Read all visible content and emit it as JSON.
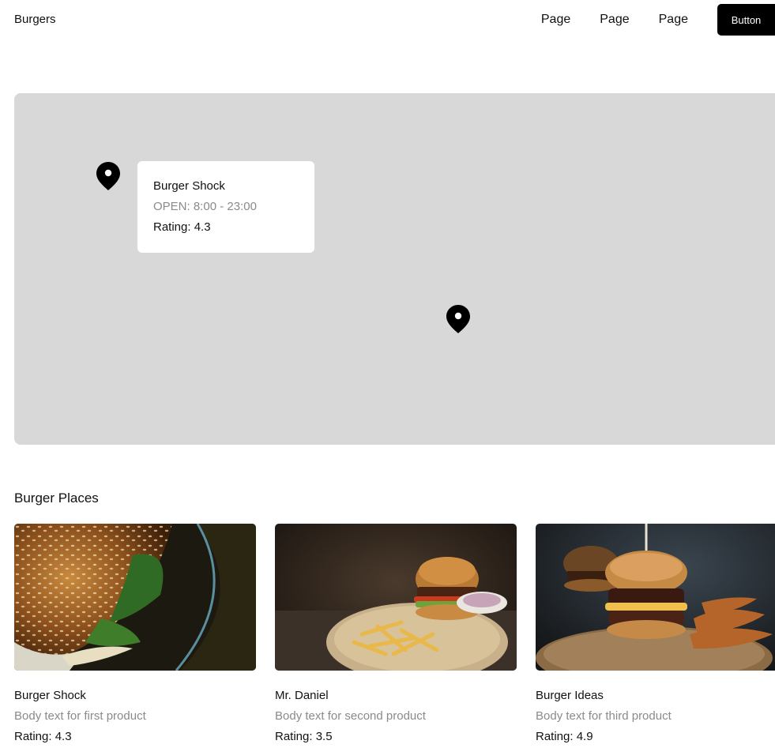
{
  "header": {
    "brand": "Burgers",
    "nav": [
      "Page",
      "Page",
      "Page"
    ],
    "button_label": "Button"
  },
  "map": {
    "popup": {
      "name": "Burger Shock",
      "hours": "OPEN: 8:00 - 23:00",
      "rating": "Rating: 4.3"
    }
  },
  "section": {
    "title": "Burger Places"
  },
  "cards": [
    {
      "name": "Burger Shock",
      "body": "Body text for first product",
      "rating": "Rating: 4.3"
    },
    {
      "name": "Mr. Daniel",
      "body": "Body text for second product",
      "rating": "Rating: 3.5"
    },
    {
      "name": "Burger Ideas",
      "body": "Body text for third product",
      "rating": "Rating: 4.9"
    }
  ],
  "colors": {
    "map_bg": "#d8d8d8",
    "button_bg": "#000000",
    "muted_text": "#8a8a8a"
  },
  "icons": {
    "pin": "map-pin-icon"
  }
}
